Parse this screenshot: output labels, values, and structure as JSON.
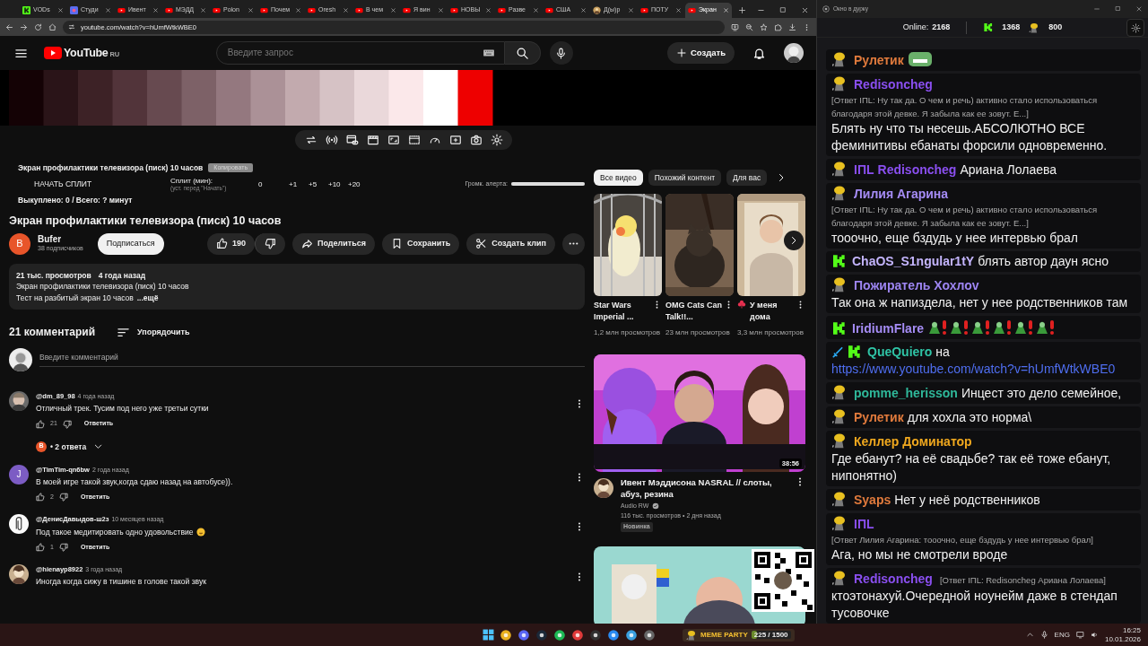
{
  "browser": {
    "tabs": [
      {
        "label": "VODs",
        "kind": "kick",
        "selected": false
      },
      {
        "label": "Студи",
        "kind": "studio",
        "selected": false
      },
      {
        "label": "Ивент",
        "kind": "youtube",
        "selected": false
      },
      {
        "label": "МЭДД",
        "kind": "youtube",
        "selected": false
      },
      {
        "label": "Polon",
        "kind": "youtube",
        "selected": false
      },
      {
        "label": "Почем",
        "kind": "youtube",
        "selected": false
      },
      {
        "label": "Oresh",
        "kind": "youtube",
        "selected": false
      },
      {
        "label": "В чем",
        "kind": "youtube",
        "selected": false
      },
      {
        "label": "Я вин",
        "kind": "youtube",
        "selected": false
      },
      {
        "label": "НОВЫ",
        "kind": "youtube",
        "selected": false
      },
      {
        "label": "Разве",
        "kind": "youtube",
        "selected": false
      },
      {
        "label": "США",
        "kind": "youtube",
        "selected": false
      },
      {
        "label": "Д(ы)р",
        "kind": "avatar",
        "selected": false
      },
      {
        "label": "ПОТУ",
        "kind": "youtube",
        "selected": false
      },
      {
        "label": "Экран",
        "kind": "youtube",
        "selected": true
      }
    ],
    "address": "youtube.com/watch?v=hUmfWtkWBE0"
  },
  "youtube": {
    "logo": "YouTube",
    "region": "RU",
    "search_placeholder": "Введите запрос",
    "create_button": "Создать",
    "extension": {
      "title": "Экран профилактики телевизора (писк) 10 часов",
      "copy_button": "Копировать",
      "start_button": "НАЧАТЬ СПЛИТ",
      "split_label": "Сплит (мин):",
      "split_hint": "(уст. перед \"Начать\")",
      "split_value": "0",
      "increments": [
        "+1",
        "+5",
        "+10",
        "+20"
      ],
      "volume_label": "Громк. алерта:",
      "volume": {
        "level": 1
      },
      "summary": "Выкуплено: 0 / Всего: ? минут"
    },
    "video": {
      "title": "Экран профилактики телевизора (писк) 10 часов",
      "channel": "Bufer",
      "channel_letter": "B",
      "subscribers": "38 подписчиков",
      "subscribe_button": "Подписаться",
      "likes": "190",
      "share_button": "Поделиться",
      "save_button": "Сохранить",
      "clip_button": "Создать клип",
      "description": {
        "views": "21 тыс. просмотров",
        "age": "4 года назад",
        "lines": [
          "Экран профилактики телевизора (писк) 10 часов",
          "Тест на разбитый экран 10 часов"
        ],
        "more": "...ещё"
      }
    },
    "comments": {
      "count": "21 комментарий",
      "sort": "Упорядочить",
      "placeholder": "Введите комментарий",
      "items": [
        {
          "author": "@dm_89_98",
          "time": "4 года назад",
          "text": "Отличный трек. Тусим под него уже третьи сутки",
          "likes": "21",
          "reply_button": "Ответить",
          "replies": {
            "letter": "B",
            "color": "#e8552a",
            "label": "• 2 ответа"
          }
        },
        {
          "author": "@TimTim-qn6bw",
          "time": "2 года назад",
          "text": "В моей игре такой звук,когда сдаю назад на автобусе)).",
          "likes": "2",
          "reply_button": "Ответить",
          "avatar": {
            "kind": "letter",
            "letter": "J",
            "color": "#7c5cc4"
          }
        },
        {
          "author": "@ДенисДавыдов-ш2з",
          "time": "10 месяцев назад",
          "text": "Под такое медитировать одно удовольствие",
          "smiley": true,
          "likes": "1",
          "reply_button": "Ответить"
        },
        {
          "author": "@hienayp8922",
          "time": "3 года назад",
          "text": "Иногда когда сижу в тишине в голове такой звук"
        }
      ]
    },
    "side": {
      "chips": [
        {
          "label": "Все видео",
          "selected": true
        },
        {
          "label": "Похожий контент",
          "selected": false
        },
        {
          "label": "Для вас",
          "selected": false
        }
      ],
      "shorts": [
        {
          "title": "Star Wars Imperial ...",
          "views": "1,2 млн просмотров"
        },
        {
          "title": "OMG Cats Can Talk!!...",
          "views": "23 млн просмотров"
        },
        {
          "title": "У меня дома",
          "flower": true,
          "views": "3,3 млн просмотров"
        }
      ],
      "video": {
        "title": "Ивент Мэддисона NASRAL // слоты, абуз, резина",
        "channel": "Audio RW",
        "verified": true,
        "meta": "116 тыс. просмотров • 2 дня назад",
        "badge": "Новинка",
        "duration": "38:56"
      }
    }
  },
  "chat": {
    "title": "Окно в дурку",
    "online_label": "Online:",
    "online": "2168",
    "kick_count": "1368",
    "points": "800",
    "messages": [
      {
        "badges": [
          {
            "kind": "blob"
          }
        ],
        "name": "Рулетик",
        "color": "#e07a3c",
        "emotes": [
          {
            "kind": "grin"
          }
        ]
      },
      {
        "badges": [
          {
            "kind": "blob"
          }
        ],
        "name": "Redisoncheg",
        "color": "#8a4ff0",
        "reply": "[Ответ IПL: Ну так да. О чем и речь) активно стало использоваться благодаря этой девке. Я забыла как ее зовут. E...]",
        "text": "Блять ну что ты несешь.АБСОЛЮТНО ВСЕ феминитивы ебанаты форсили одновременно."
      },
      {
        "badges": [
          {
            "kind": "blob"
          }
        ],
        "name": "IПL",
        "color": "#8a4ff0",
        "mention": "Redisoncheg",
        "text": "Ариана Лолаева"
      },
      {
        "badges": [
          {
            "kind": "blob"
          }
        ],
        "name": "Лилия Агарина",
        "color": "#a58cf5",
        "reply": "[Ответ IПL: Ну так да. О чем и речь) активно стало использоваться благодаря этой девке. Я забыла как ее зовут. E...]",
        "text": "тооочно, еще бздудь у нее интервью брал"
      },
      {
        "badges": [
          {
            "kind": "kick"
          }
        ],
        "name": "ChaOS_S1ngular1tY",
        "color": "#c4b5fd",
        "text": "блять автор даун ясно"
      },
      {
        "badges": [
          {
            "kind": "blob"
          }
        ],
        "name": "Пожиратель Хохлоv",
        "color": "#9d85f2",
        "text": "Так она ж напиздела, нет у нее родственников там"
      },
      {
        "badges": [
          {
            "kind": "kick"
          }
        ],
        "name": "IridiumFlare",
        "color": "#a58cf5",
        "emotes": [
          {
            "kind": "pepe"
          },
          {
            "kind": "pepe"
          },
          {
            "kind": "pepe"
          },
          {
            "kind": "pepe"
          },
          {
            "kind": "pepe"
          },
          {
            "kind": "pepe"
          }
        ]
      },
      {
        "badges": [
          {
            "kind": "sword"
          },
          {
            "kind": "kick"
          }
        ],
        "name": "QueQuiero",
        "color": "#2fc4a6",
        "text": "на",
        "link": "https://www.youtube.com/watch?v=hUmfWtkWBE0"
      },
      {
        "badges": [
          {
            "kind": "blob"
          }
        ],
        "name": "pomme_herisson",
        "color": "#2fb89a",
        "text": "Инцест это дело семейное,"
      },
      {
        "badges": [
          {
            "kind": "blob"
          }
        ],
        "name": "Рулетик",
        "color": "#e07a3c",
        "text": "для хохла это норма\\"
      },
      {
        "badges": [
          {
            "kind": "blob"
          }
        ],
        "name": "Келлер Доминатор",
        "color": "#f0a81e",
        "text": "Где ебанут? на её свадьбе? так её тоже ебанут, нипонятно)"
      },
      {
        "badges": [
          {
            "kind": "blob"
          }
        ],
        "name": "Syaps",
        "color": "#e07a3c",
        "text": "Нет у неё родственников"
      },
      {
        "badges": [
          {
            "kind": "blob"
          }
        ],
        "name": "IПL",
        "color": "#8a4ff0",
        "reply": "[Ответ Лилия Агарина: тооочно, еще бздудь у нее интервью брал]",
        "text": "Ага, но мы не смотрели вроде"
      },
      {
        "badges": [
          {
            "kind": "blob"
          }
        ],
        "name": "Redisoncheg",
        "color": "#8a4ff0",
        "reply": "[Ответ IПL: Redisoncheg Ариана Лолаева]",
        "text": "ктоэтонахуй.Очередной ноунейм даже в стендап тусовочке"
      }
    ]
  },
  "taskbar": {
    "widget_title": "MEME PARTY",
    "widget_progress": {
      "text": "225 / 1500",
      "level": 0.15
    },
    "language": "ENG",
    "time": "16:25",
    "date": "10.01.2026"
  }
}
